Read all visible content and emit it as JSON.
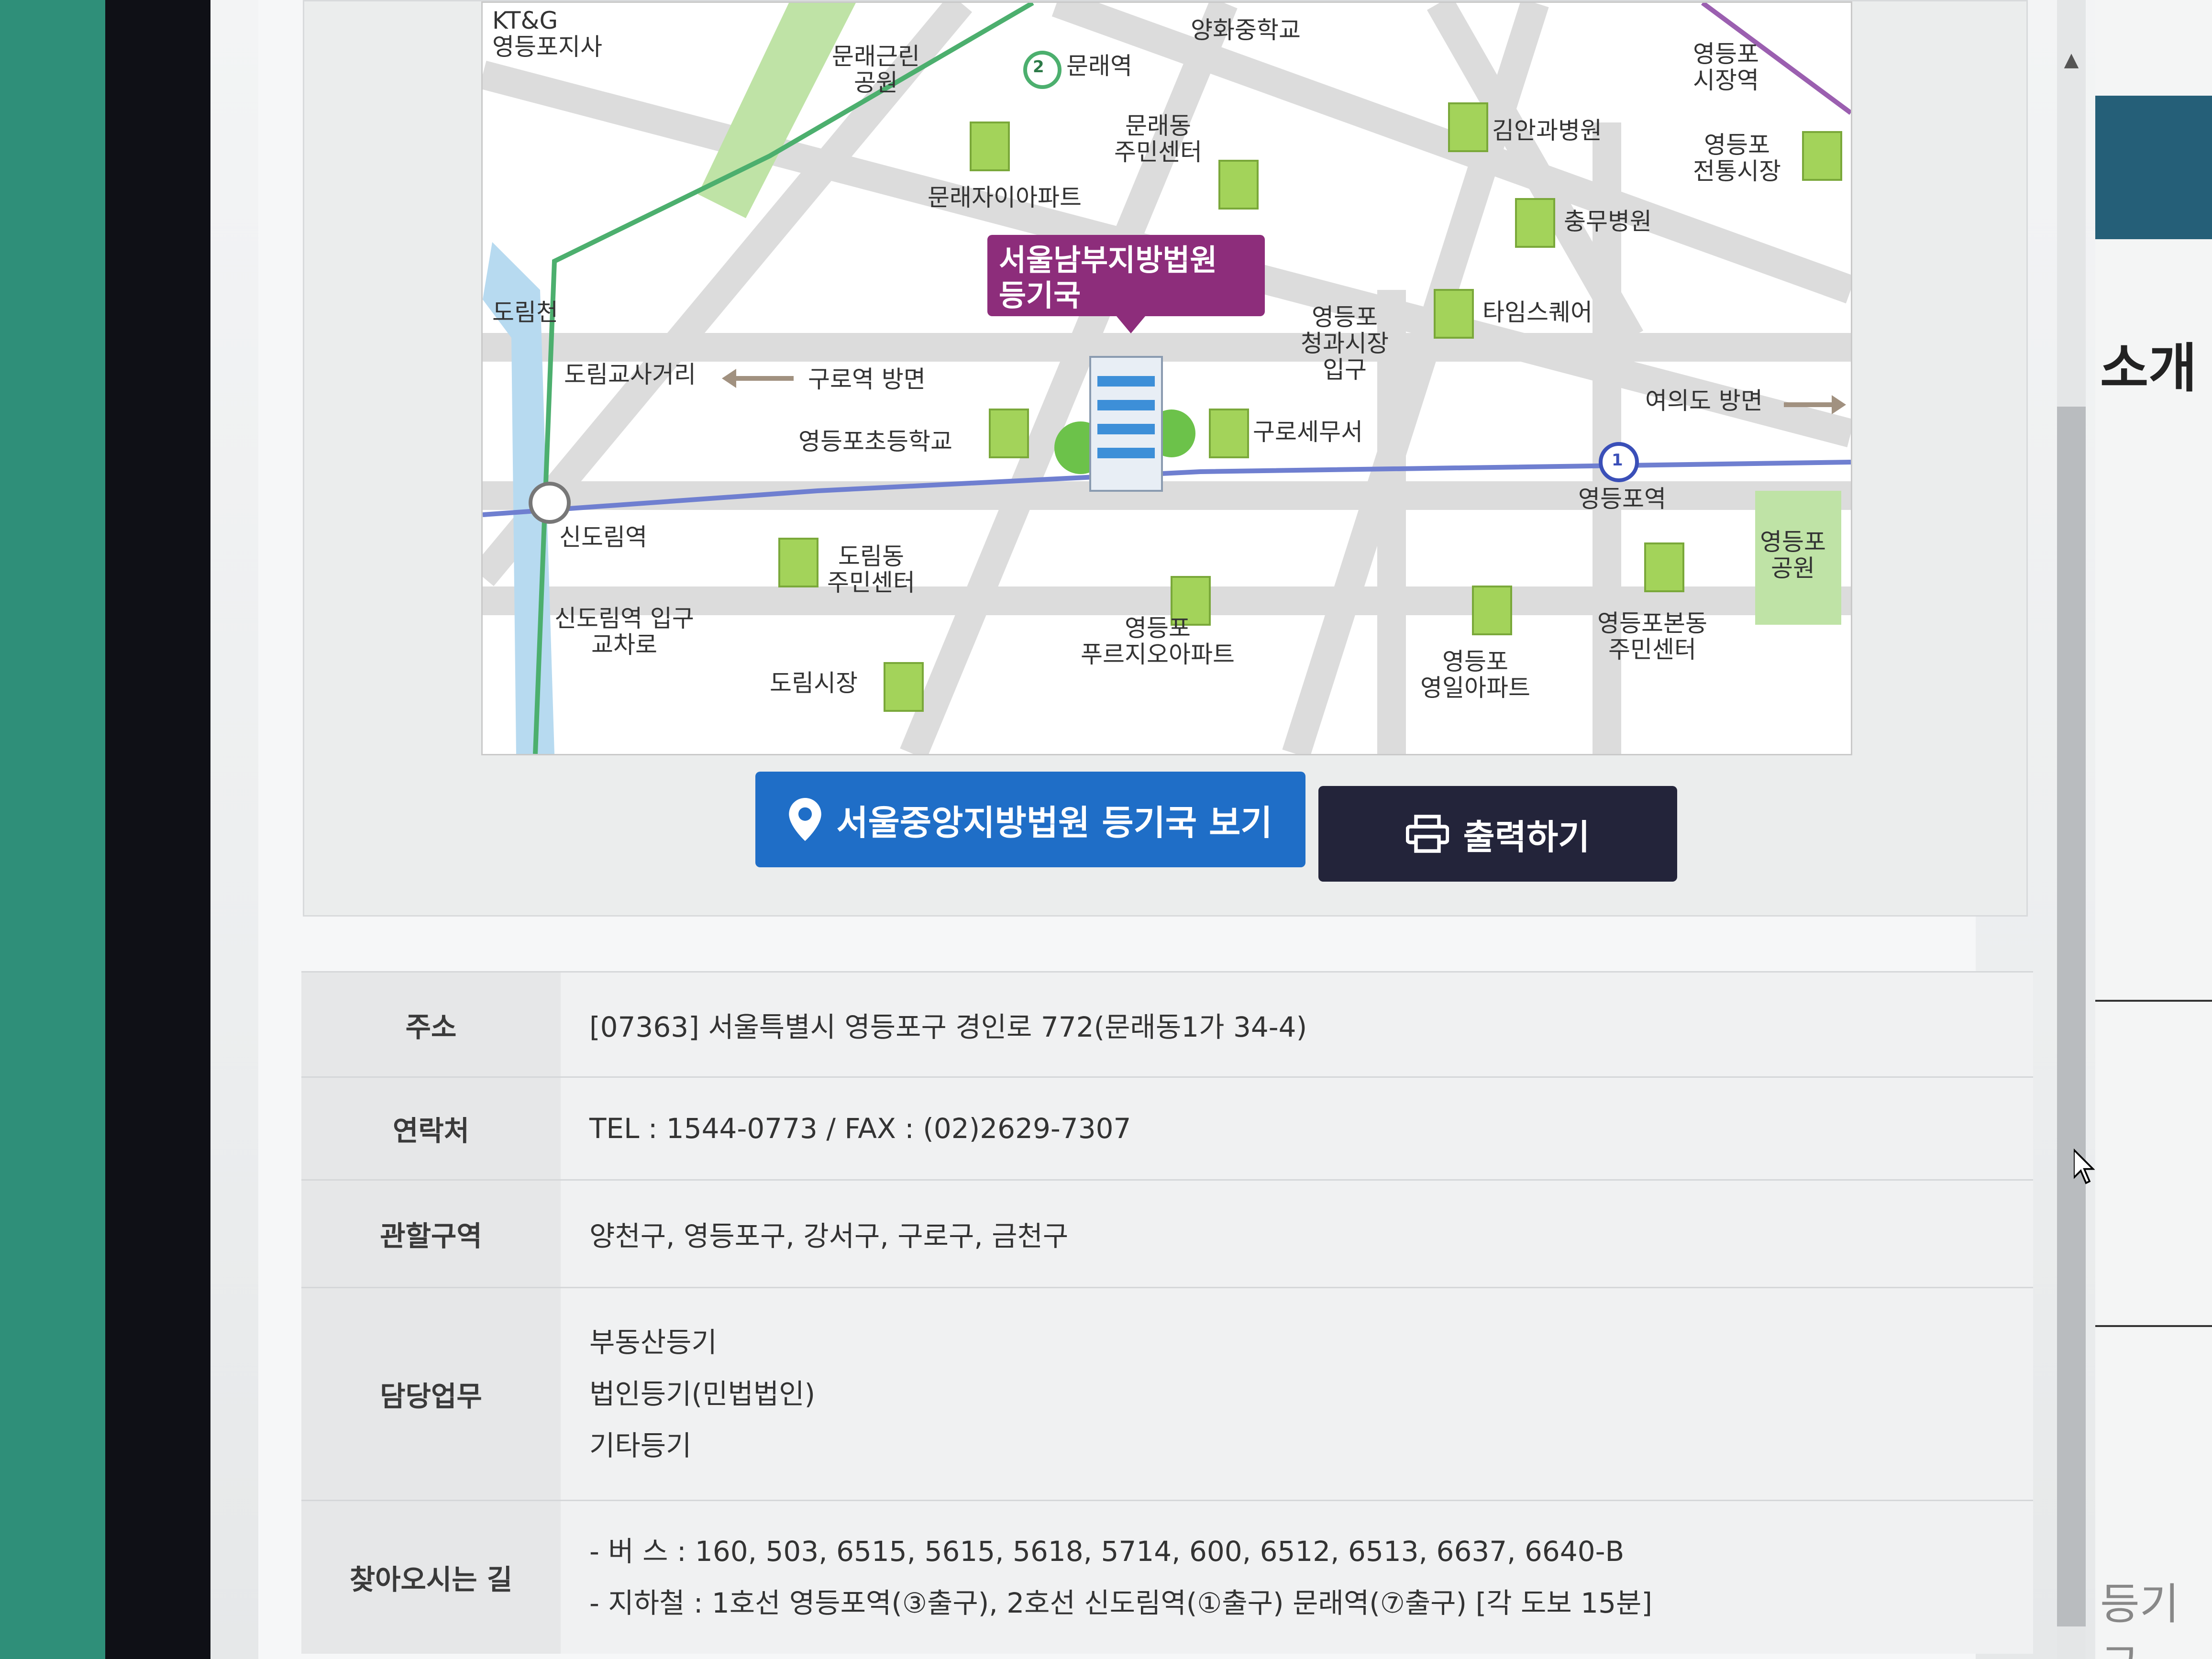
{
  "map": {
    "court_label": "서울남부지방법원\n등기국",
    "labels": {
      "ktg": "KT&G\n영등포지사",
      "park": "문래근린\n공원",
      "mullae_station": "문래역",
      "yanghwa_school": "양화중학교",
      "mullae_center": "문래동\n주민센터",
      "mullae_apt": "문래자이아파트",
      "kim_hospital": "김안과병원",
      "market_station": "영등포\n시장역",
      "traditional_market": "영등포\n전통시장",
      "chungmu_hospital": "충무병원",
      "times_square": "타임스퀘어",
      "doriimcheon": "도림천",
      "dorim_crossroad": "도림교사거리",
      "guro_dir": "구로역 방면",
      "fruit_market": "영등포\n청과시장\n입구",
      "yeouido_dir": "여의도 방면",
      "school": "영등포초등학교",
      "tax_office": "구로세무서",
      "sindorim_station": "신도림역",
      "yeongdeungpo_station": "영등포역",
      "yeongdeungpo_park": "영등포\n공원",
      "dorim_center": "도림동\n주민센터",
      "sindorim_entrance": "신도림역 입구\n교차로",
      "bonedong_center": "영등포본동\n주민센터",
      "prugio": "영등포\n푸르지오아파트",
      "yeongil_apt": "영등포\n영일아파트",
      "dorim_market": "도림시장",
      "line2_num": "2",
      "line1_num": "1"
    }
  },
  "buttons": {
    "view_seoul_central": "서울중앙지방법원 등기국 보기",
    "print": "출력하기"
  },
  "info": {
    "address_label": "주소",
    "address_value": "[07363] 서울특별시 영등포구 경인로 772(문래동1가 34-4)",
    "contact_label": "연락처",
    "contact_value": "TEL : 1544-0773 / FAX : (02)2629-7307",
    "jurisdiction_label": "관할구역",
    "jurisdiction_value": "양천구, 영등포구, 강서구, 구로구, 금천구",
    "duties_label": "담당업무",
    "duties": [
      "부동산등기",
      "법인등기(민법법인)",
      "기타등기"
    ],
    "directions_label": "찾아오시는 길",
    "directions": [
      "- 버 스 : 160, 503, 6515, 5615, 5618, 5714, 600, 6512, 6513, 6637, 6640-B",
      "- 지하철 : 1호선 영등포역(③출구), 2호선 신도림역(①출구) 문래역(⑦출구) [각 도보 15분]"
    ]
  },
  "right_panel": {
    "title": "소개",
    "footer": "등기국"
  },
  "colors": {
    "court_label_bg": "#8d2d7b",
    "button_blue": "#1f6ec7",
    "button_dark": "#23243a",
    "subway_line1": "#6f7fd0",
    "subway_line2": "#4caf6e"
  }
}
